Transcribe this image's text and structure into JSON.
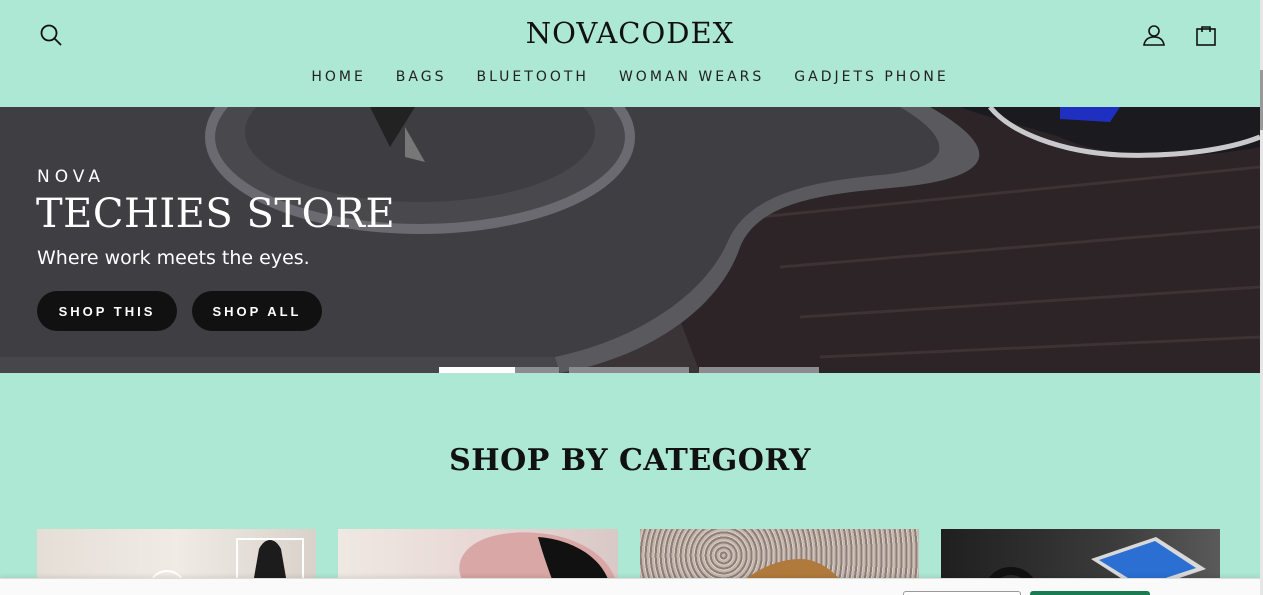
{
  "header": {
    "logo": "NOVACODEX",
    "icons": {
      "search": "search-icon",
      "account": "user-icon",
      "cart": "bag-icon"
    },
    "nav": [
      {
        "label": "HOME"
      },
      {
        "label": "BAGS"
      },
      {
        "label": "BLUETOOTH"
      },
      {
        "label": "WOMAN WEARS"
      },
      {
        "label": "GADJETS PHONE"
      }
    ]
  },
  "hero": {
    "eyebrow": "NOVA",
    "title": "TECHIES STORE",
    "subtitle": "Where work meets the eyes.",
    "buttons": {
      "shop_this": "SHOP THIS",
      "shop_all": "SHOP ALL"
    },
    "slides": {
      "count": 3,
      "active": 1,
      "active_progress": 0.63
    }
  },
  "category": {
    "title": "SHOP BY CATEGORY"
  },
  "colors": {
    "background": "#ace8d4",
    "button": "#111111",
    "accept": "#1a7a52"
  }
}
